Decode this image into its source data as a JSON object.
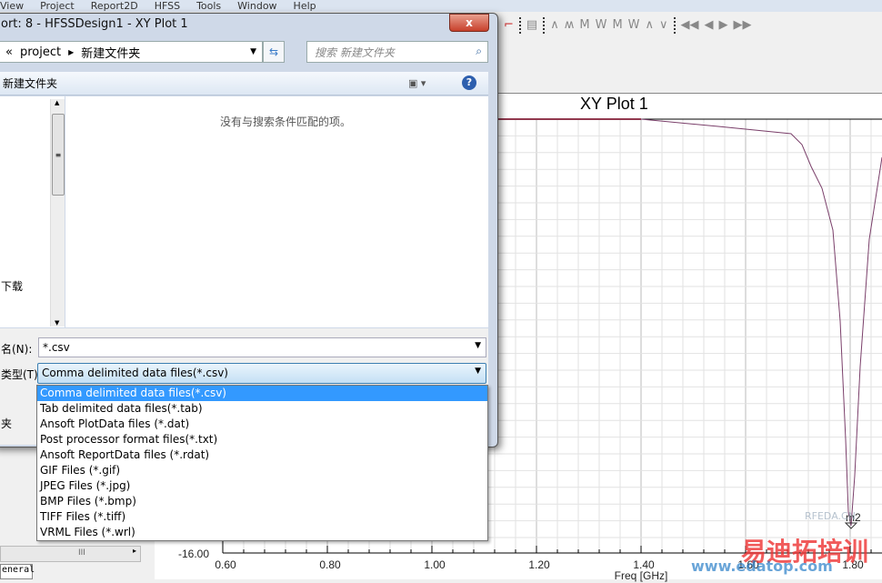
{
  "menu": [
    "View",
    "Project",
    "Report2D",
    "HFSS",
    "Tools",
    "Window",
    "Help"
  ],
  "plot": {
    "title": "XY Plot 1",
    "y_tick": "-16.00",
    "x_ticks": [
      "0.60",
      "0.80",
      "1.00",
      "1.20",
      "1.40",
      "1.60",
      "1.80"
    ],
    "x_label": "Freq [GHz]",
    "marker": "m2",
    "line_color": "#7a3f6a"
  },
  "dialog": {
    "title": "ort: 8 - HFSSDesign1 - XY Plot 1",
    "close": "x",
    "breadcrumb": [
      "«",
      "project",
      "新建文件夹"
    ],
    "search_placeholder": "搜索 新建文件夹",
    "cmd_folder": "新建文件夹",
    "nav_item": "下载",
    "empty_message": "没有与搜索条件匹配的项。",
    "filename_label": "名(N):",
    "filename_value": "*.csv",
    "filetype_label": "类型(T):",
    "filetype_value": "Comma delimited data files(*.csv)",
    "folder_button": "夹"
  },
  "filetype_options": [
    "Comma delimited data files(*.csv)",
    "Tab delimited data files(*.tab)",
    "Ansoft PlotData files (*.dat)",
    "Post processor format files(*.txt)",
    "Ansoft ReportData files (*.rdat)",
    "GIF Files (*.gif)",
    "JPEG Files (*.jpg)",
    "BMP Files (*.bmp)",
    "TIFF Files (*.tiff)",
    "VRML Files (*.wrl)"
  ],
  "left_panel": {
    "tab": "eneral",
    "scroll_grip": "III"
  },
  "watermark": {
    "text": "易迪拓培训",
    "url": "www.edatop.com",
    "small": "RFEDA.CN"
  }
}
